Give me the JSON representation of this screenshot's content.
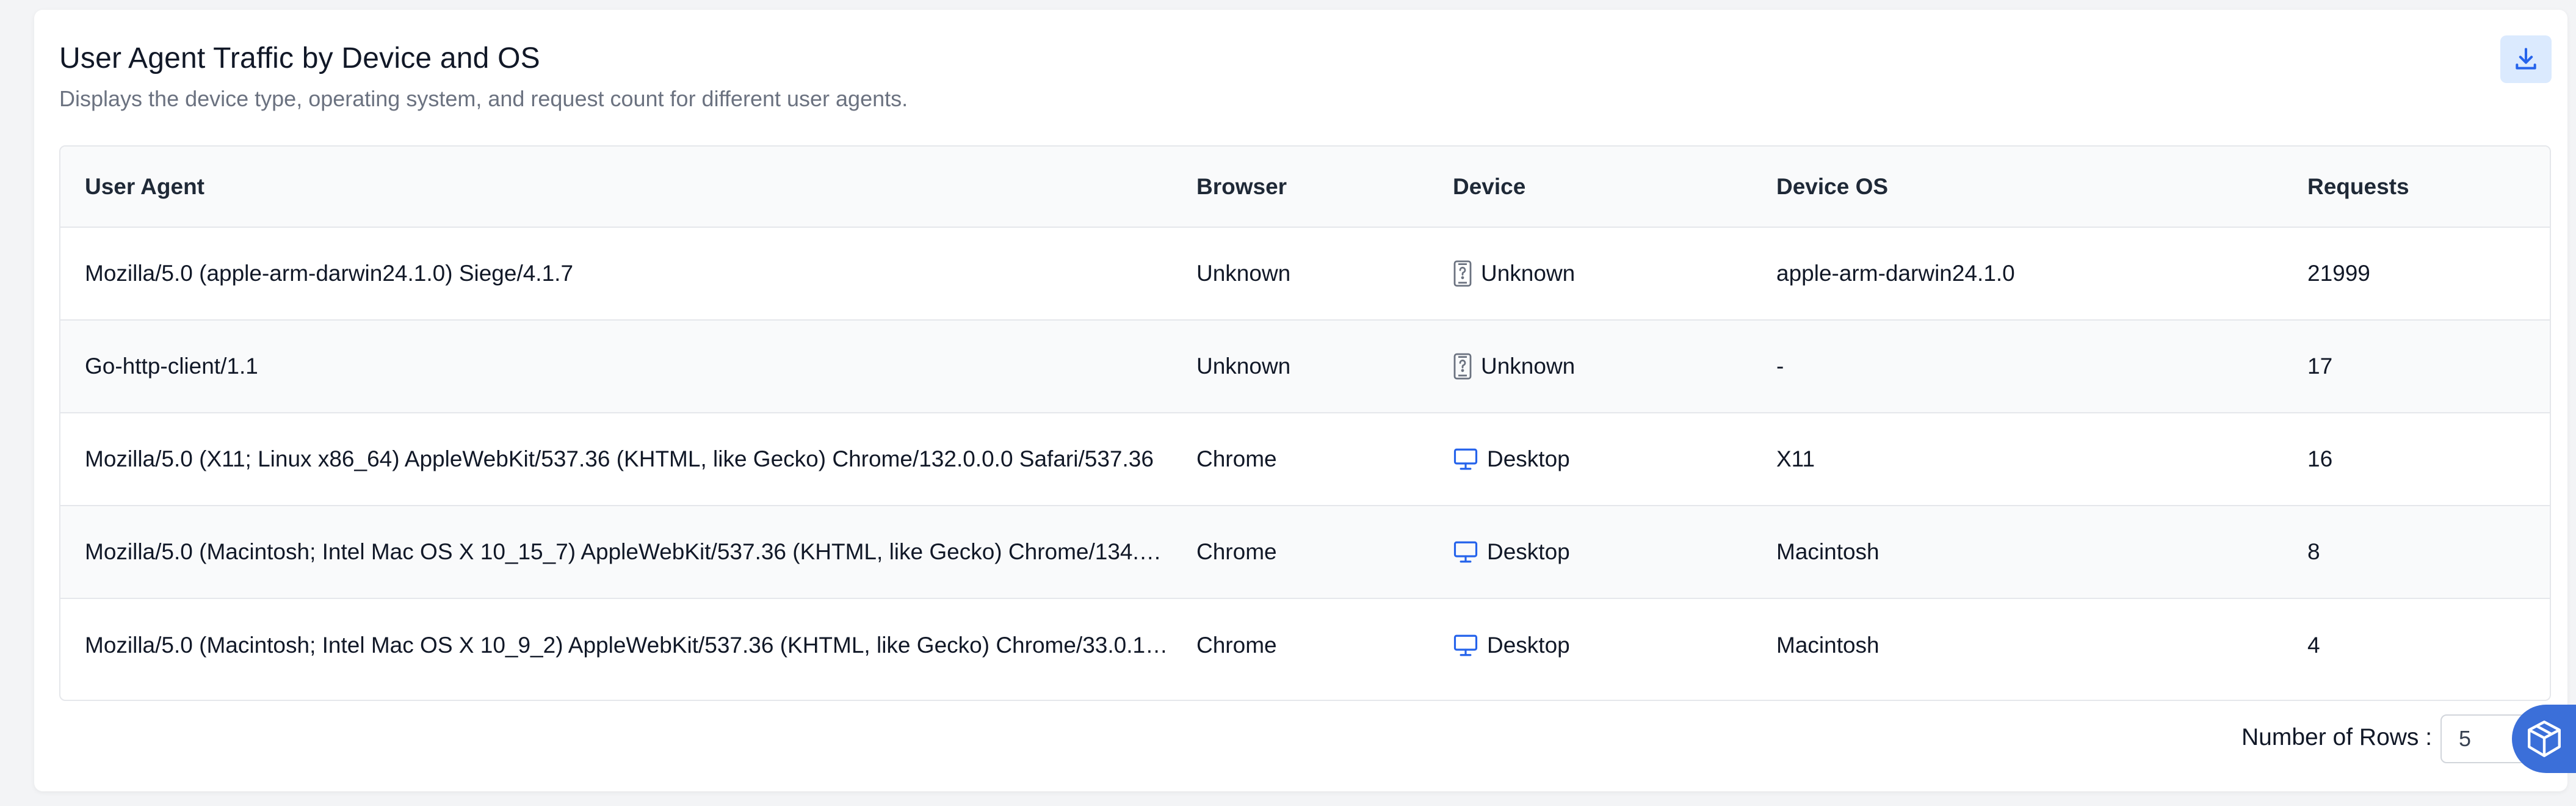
{
  "header": {
    "title": "User Agent Traffic by Device and OS",
    "subtitle": "Displays the device type, operating system, and request count for different user agents."
  },
  "table": {
    "columns": [
      "User Agent",
      "Browser",
      "Device",
      "Device OS",
      "Requests"
    ],
    "rows": [
      {
        "user_agent": "Mozilla/5.0 (apple-arm-darwin24.1.0) Siege/4.1.7",
        "browser": "Unknown",
        "device": "Unknown",
        "device_icon": "unknown-device-icon",
        "os": "apple-arm-darwin24.1.0",
        "requests": "21999"
      },
      {
        "user_agent": "Go-http-client/1.1",
        "browser": "Unknown",
        "device": "Unknown",
        "device_icon": "unknown-device-icon",
        "os": "-",
        "requests": "17"
      },
      {
        "user_agent": "Mozilla/5.0 (X11; Linux x86_64) AppleWebKit/537.36 (KHTML, like Gecko) Chrome/132.0.0.0 Safari/537.36",
        "browser": "Chrome",
        "device": "Desktop",
        "device_icon": "desktop-icon",
        "os": "X11",
        "requests": "16"
      },
      {
        "user_agent": "Mozilla/5.0 (Macintosh; Intel Mac OS X 10_15_7) AppleWebKit/537.36 (KHTML, like Gecko) Chrome/134.0....",
        "browser": "Chrome",
        "device": "Desktop",
        "device_icon": "desktop-icon",
        "os": "Macintosh",
        "requests": "8"
      },
      {
        "user_agent": "Mozilla/5.0 (Macintosh; Intel Mac OS X 10_9_2) AppleWebKit/537.36 (KHTML, like Gecko) Chrome/33.0.17...",
        "browser": "Chrome",
        "device": "Desktop",
        "device_icon": "desktop-icon",
        "os": "Macintosh",
        "requests": "4"
      }
    ]
  },
  "footer": {
    "rows_label": "Number of Rows :",
    "rows_value": "5"
  },
  "icons": {
    "download": "download-icon",
    "unknown_device": "unknown-device-icon",
    "desktop": "desktop-icon",
    "fab": "cube-box-icon"
  },
  "colors": {
    "accent": "#3b6fd9",
    "download_bg": "#dbeafe",
    "desktop_icon": "#2563eb",
    "unknown_icon": "#6b7280"
  }
}
